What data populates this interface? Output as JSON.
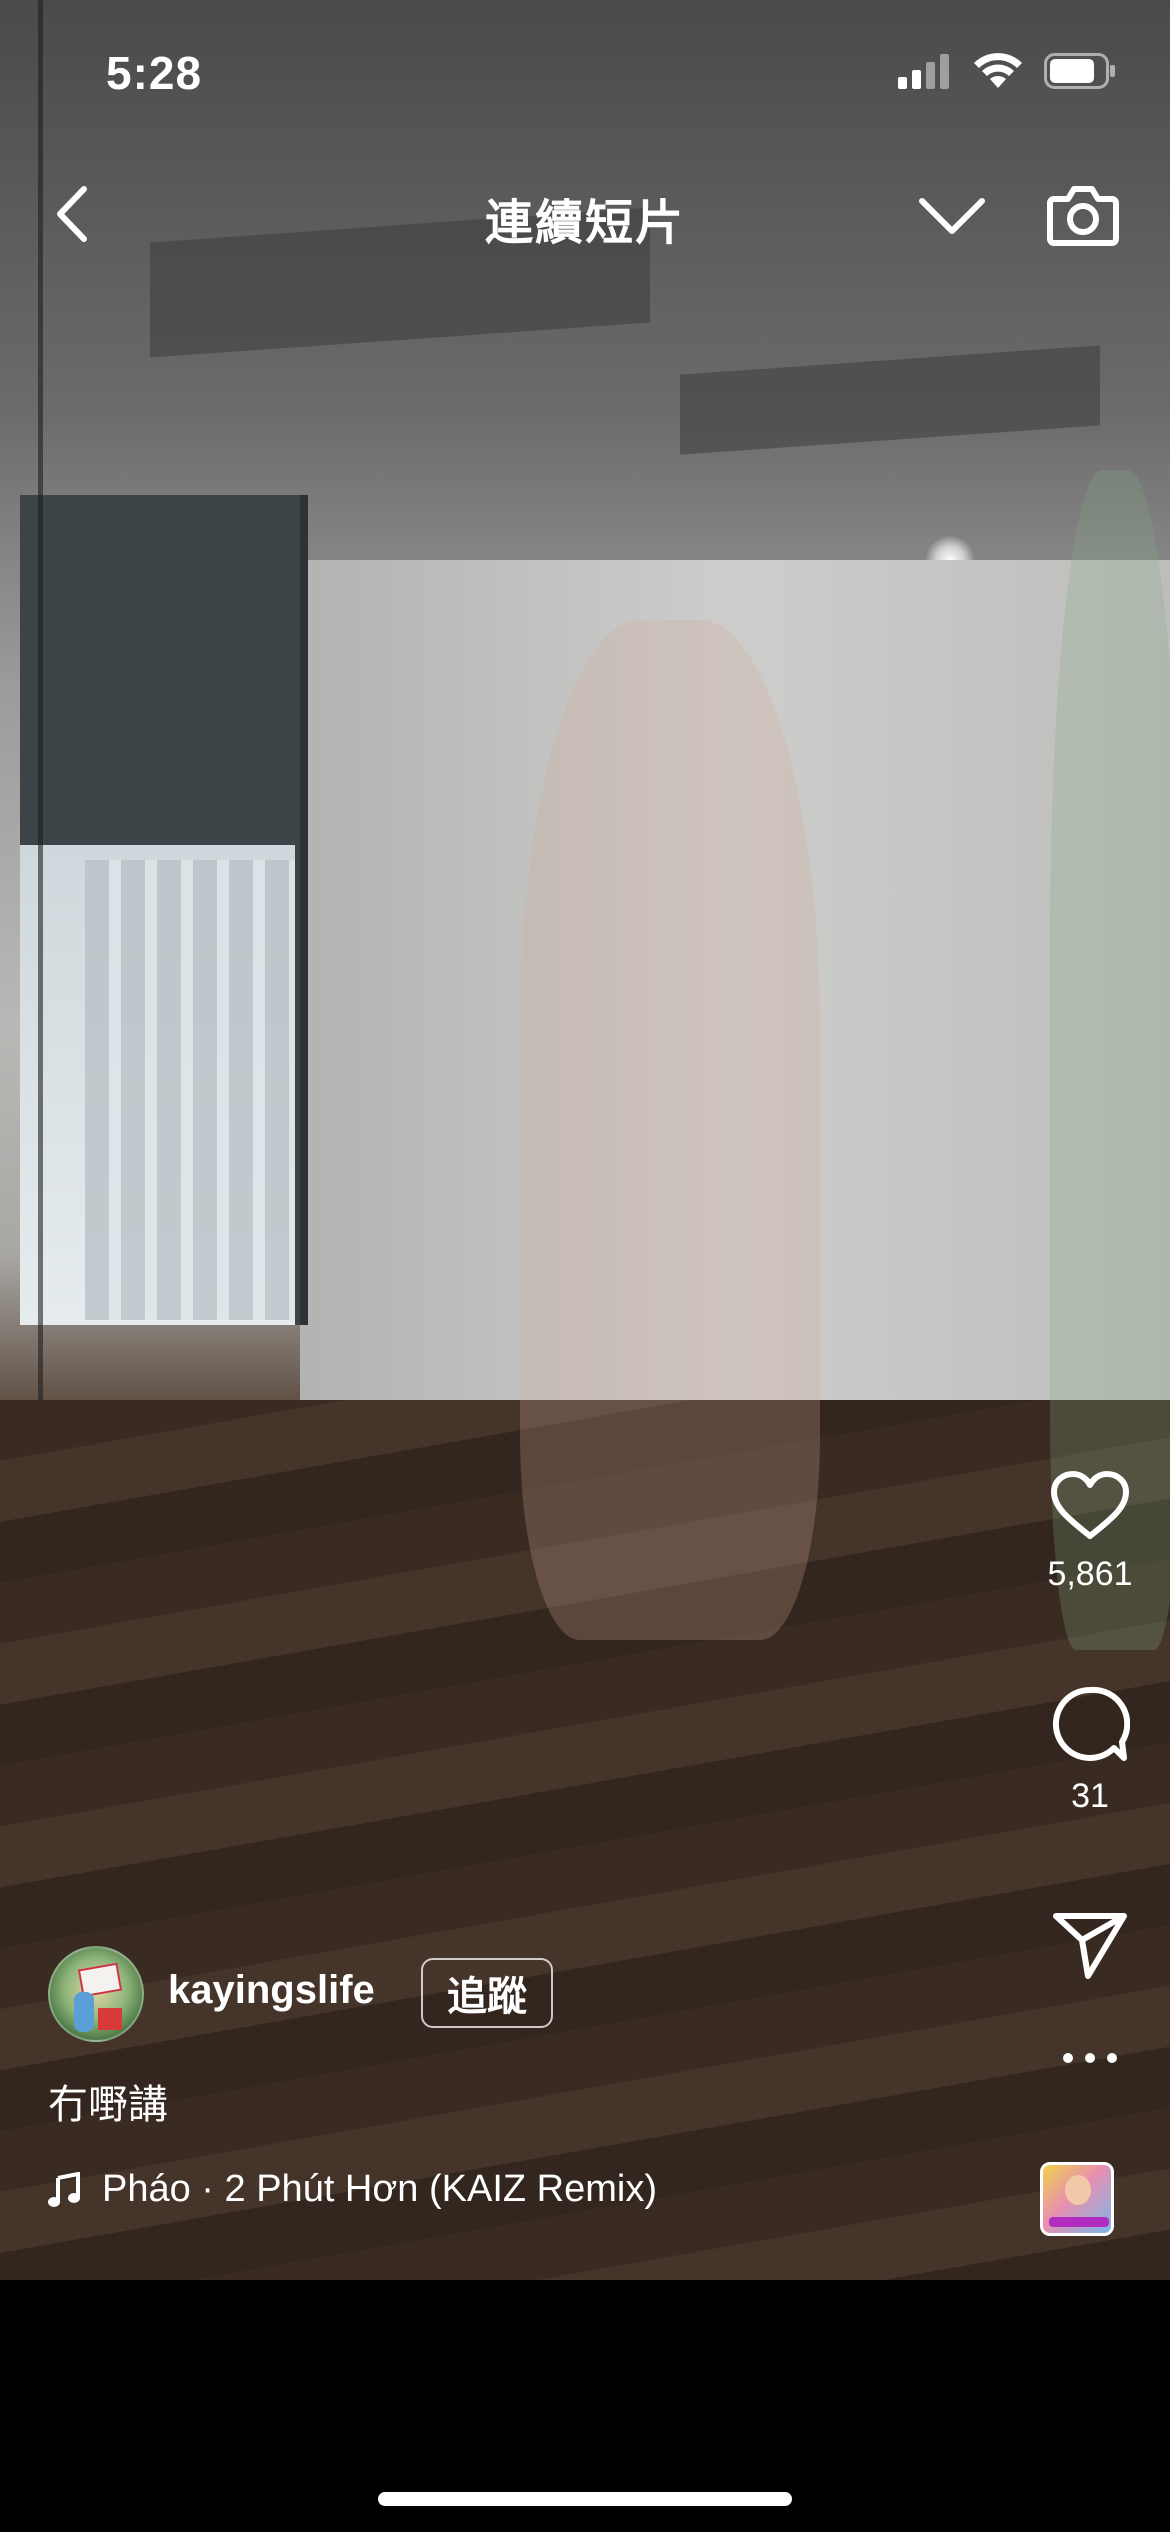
{
  "status_bar": {
    "time": "5:28",
    "icons": [
      "cellular-signal-icon",
      "wifi-icon",
      "battery-icon"
    ]
  },
  "nav": {
    "title": "連續短片",
    "icons": [
      "back-chevron-icon",
      "chevron-down-icon",
      "camera-icon"
    ]
  },
  "video": {
    "description_icons": [
      "heart-icon",
      "comment-icon",
      "send-icon",
      "more-icon"
    ]
  },
  "actions": {
    "likes": "5,861",
    "comments": "31"
  },
  "post": {
    "username": "kayingslife",
    "follow_label": "追蹤",
    "caption": "冇嘢講",
    "music": "Pháo · 2 Phút Hơn (KAIZ Remix)"
  },
  "colors": {
    "background": "#000000",
    "text": "#ffffff"
  }
}
